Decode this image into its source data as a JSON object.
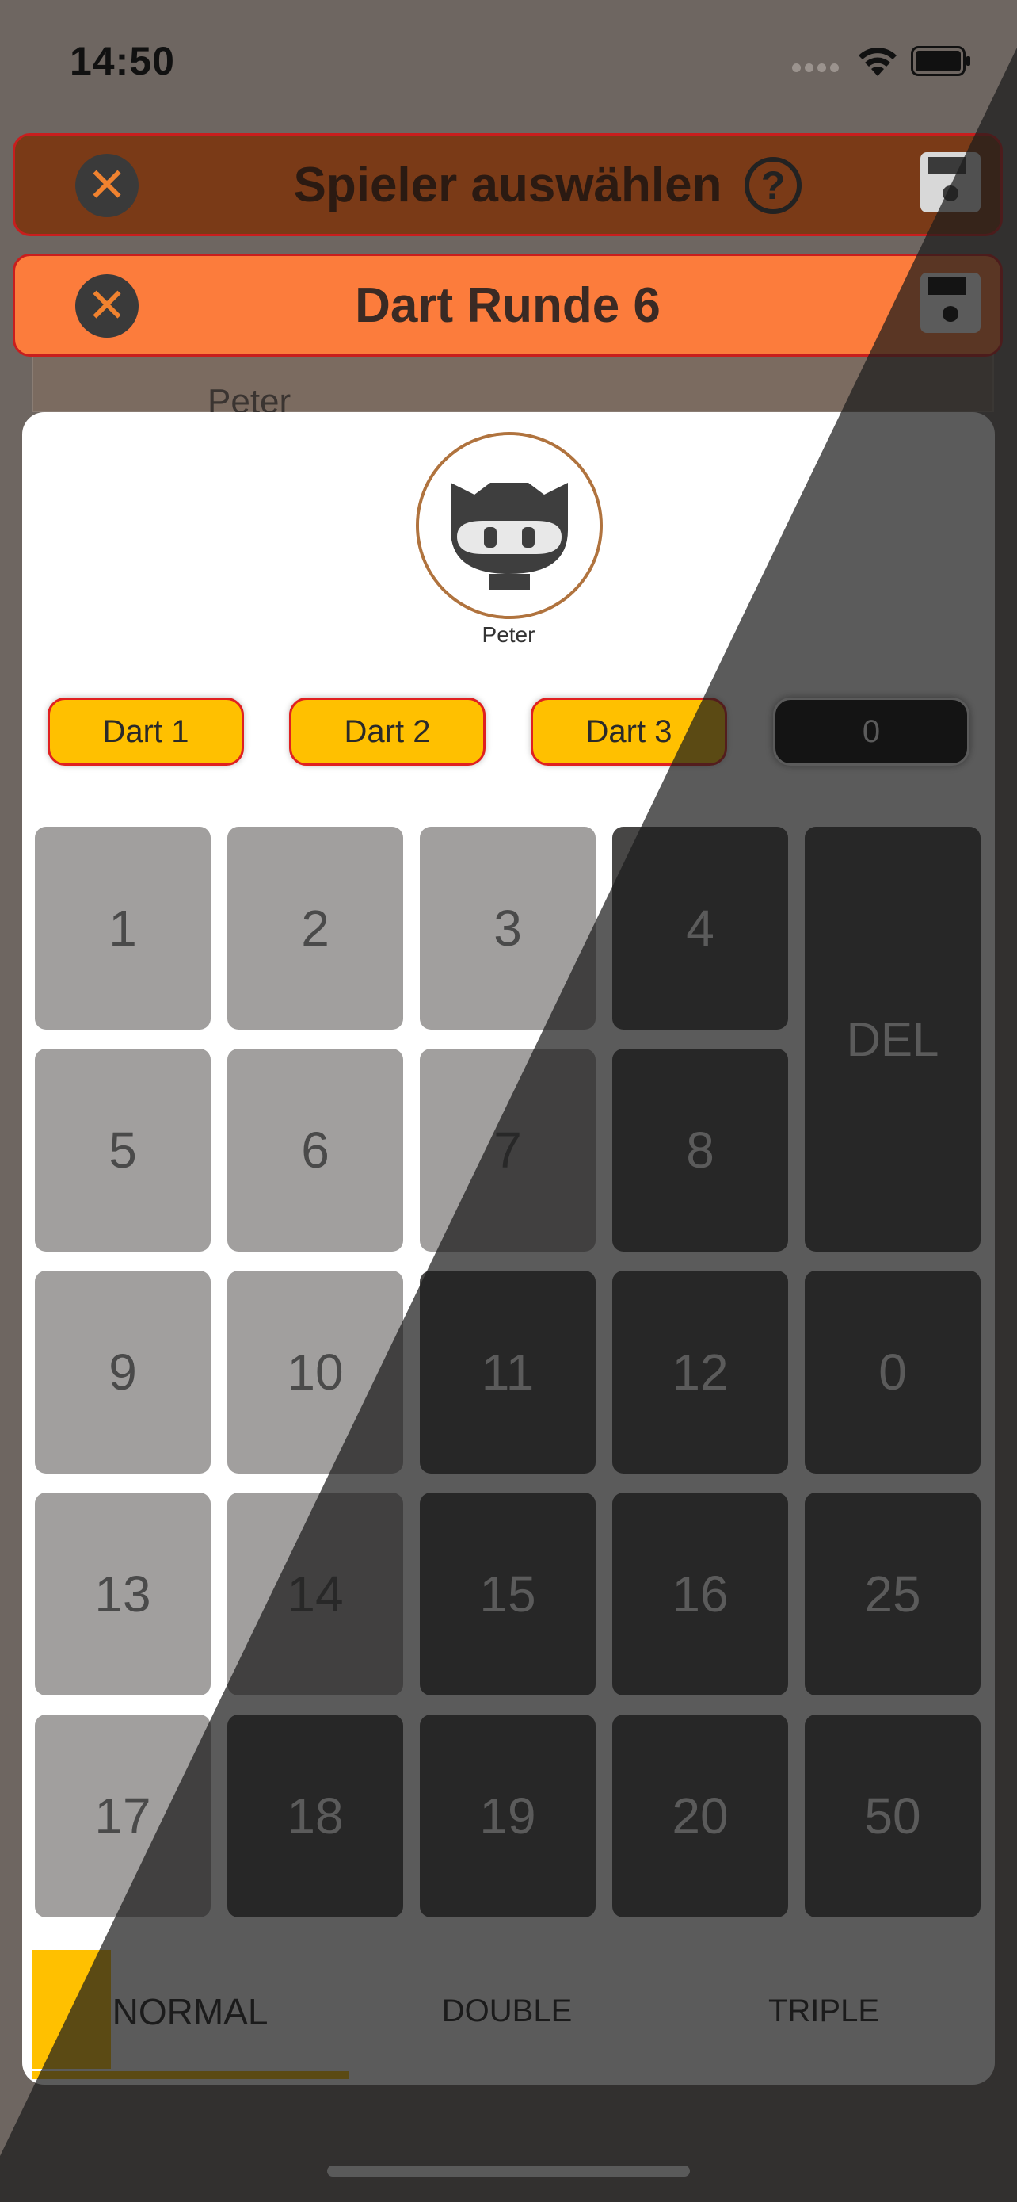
{
  "status_bar": {
    "time": "14:50"
  },
  "header_back": {
    "title": "Spieler auswählen"
  },
  "header_front": {
    "title": "Dart Runde 6"
  },
  "underlying_row": {
    "player_name": "Peter"
  },
  "player": {
    "name": "Peter"
  },
  "darts": [
    {
      "label": "Dart 1"
    },
    {
      "label": "Dart 2"
    },
    {
      "label": "Dart 3"
    }
  ],
  "total_score": "0",
  "keypad": {
    "keys": [
      "1",
      "2",
      "3",
      "4",
      "5",
      "6",
      "7",
      "8",
      "9",
      "10",
      "11",
      "12",
      "0",
      "13",
      "14",
      "15",
      "16",
      "25",
      "17",
      "18",
      "19",
      "20",
      "50"
    ],
    "delete_label": "DEL"
  },
  "modes": {
    "normal": "NORMAL",
    "double": "DOUBLE",
    "triple": "TRIPLE",
    "selected": "NORMAL"
  },
  "colors": {
    "accent": "#ffc000",
    "header_orange": "#fc7c3c",
    "header_brown": "#7a3a17",
    "key_light": "#a19f9e",
    "key_dark": "#474645"
  }
}
